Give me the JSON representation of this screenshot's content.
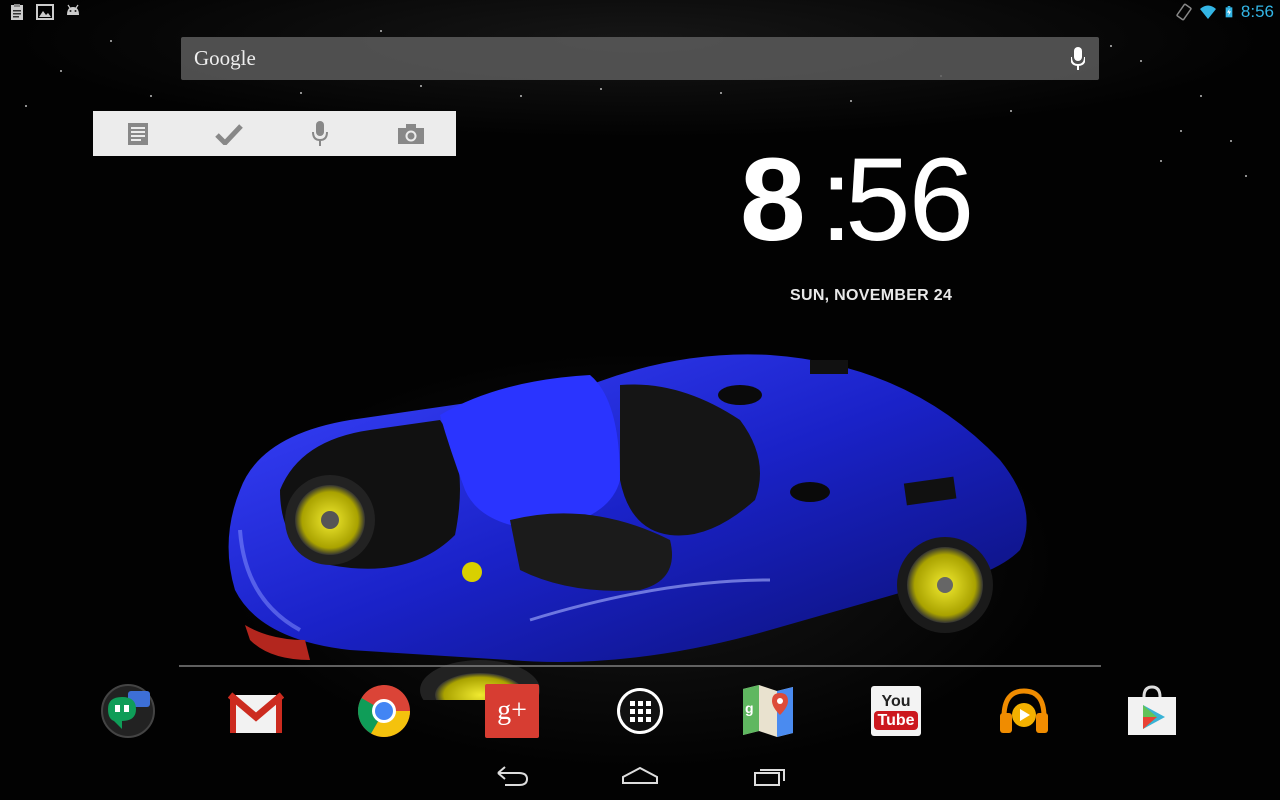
{
  "status_bar": {
    "time": "8:56",
    "left_icons": [
      "clipboard-icon",
      "image-icon",
      "android-icon"
    ],
    "right_icons": [
      "screen-rotation-icon",
      "wifi-icon",
      "battery-icon"
    ],
    "accent_color": "#33b5e5"
  },
  "search": {
    "label": "Google",
    "voice_icon": "microphone-icon"
  },
  "keep_widget": {
    "buttons": [
      "note-icon",
      "checkmark-icon",
      "microphone-icon",
      "camera-icon"
    ]
  },
  "clock": {
    "hour": "8",
    "colon": ":",
    "minutes": "56",
    "date": "SUN, NOVEMBER 24"
  },
  "dock": {
    "apps": [
      "hangouts-icon",
      "gmail-icon",
      "chrome-icon",
      "google-plus-icon",
      "all-apps-icon",
      "maps-icon",
      "youtube-icon",
      "play-music-icon",
      "play-store-icon"
    ],
    "youtube_text_top": "You",
    "youtube_text_bottom": "Tube",
    "gplus_text": "g+"
  },
  "nav_bar": {
    "buttons": [
      "back-icon",
      "home-icon",
      "recent-apps-icon"
    ]
  },
  "colors": {
    "car_body": "#1a22c8",
    "wheel": "#d6d000"
  }
}
